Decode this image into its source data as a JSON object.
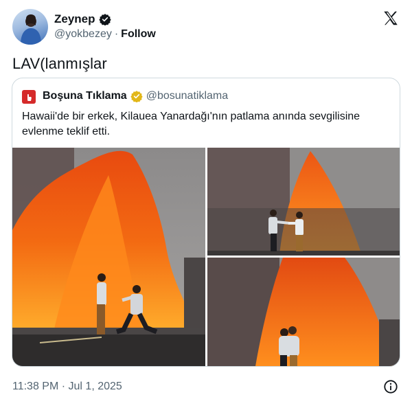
{
  "author": {
    "name": "Zeynep",
    "handle": "@yokbezey",
    "separator": "·",
    "follow_label": "Follow",
    "verified_icon": "verified-badge-icon"
  },
  "tweet": {
    "text": "LAV(lanmışlar"
  },
  "quoted": {
    "name": "Boşuna Tıklama",
    "handle": "@bosunatiklama",
    "verified_icon": "gold-verified-badge-icon",
    "text": "Hawaii'de bir erkek, Kilauea Yanardağı'nın patlama anında sevgilisine evlenme teklif etti.",
    "photos": [
      "proposal-kneeling-photo",
      "couple-standing-photo",
      "couple-hugging-photo"
    ]
  },
  "footer": {
    "timestamp": "11:38 PM · Jul 1, 2025",
    "info_icon": "info-icon"
  },
  "colors": {
    "text": "#0f1419",
    "secondary": "#536471",
    "border": "#cfd9de",
    "verified_blue": "#1d9bf0",
    "verified_gold": "#e2b719",
    "brand_red": "#d52a2a"
  }
}
